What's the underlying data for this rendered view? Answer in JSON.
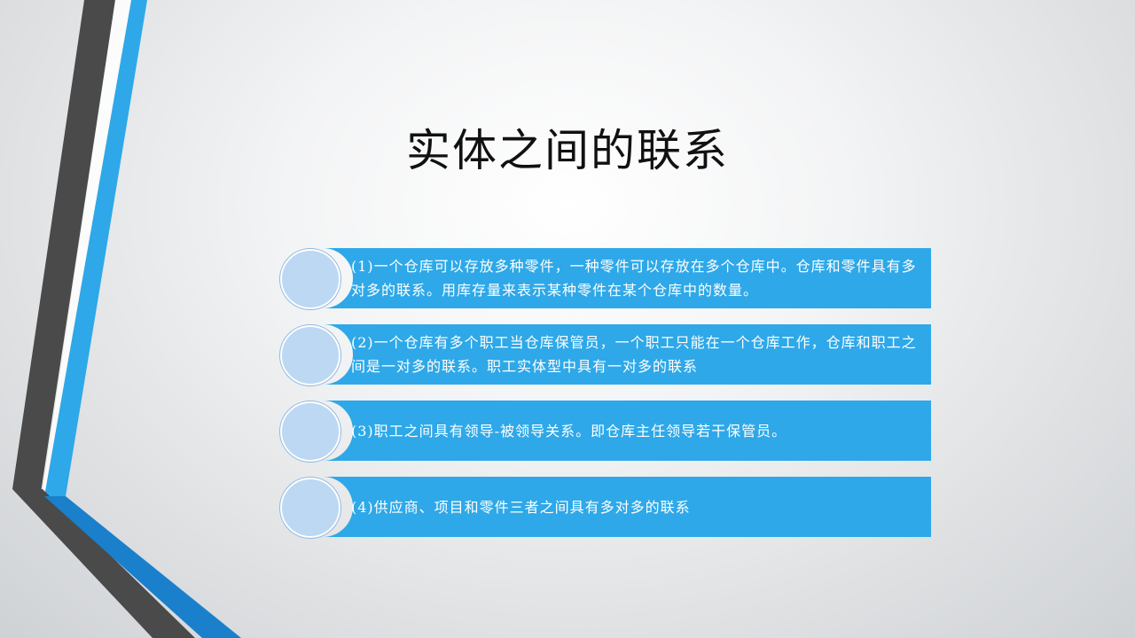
{
  "slide": {
    "title": "实体之间的联系",
    "items": [
      {
        "text": "(1)一个仓库可以存放多种零件，一种零件可以存放在多个仓库中。仓库和零件具有多对多的联系。用库存量来表示某种零件在某个仓库中的数量。"
      },
      {
        "text": "(2)一个仓库有多个职工当仓库保管员，一个职工只能在一个仓库工作，仓库和职工之间是一对多的联系。职工实体型中具有一对多的联系"
      },
      {
        "text": "(3)职工之间具有领导-被领导关系。即仓库主任领导若干保管员。"
      },
      {
        "text": "(4)供应商、项目和零件三者之间具有多对多的联系"
      }
    ]
  },
  "colors": {
    "accent_blue": "#2ea8e8",
    "deep_blue": "#1a80cc",
    "dark_gray": "#4a4a4a",
    "circle_fill": "#bcd8f2"
  }
}
